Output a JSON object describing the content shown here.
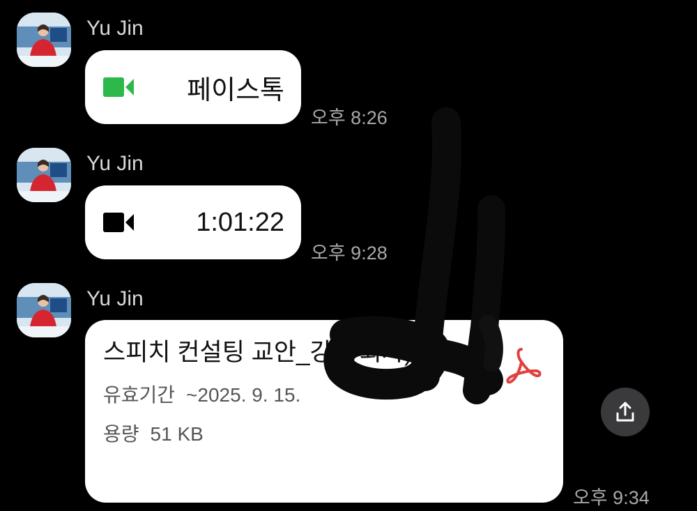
{
  "messages": [
    {
      "sender": "Yu Jin",
      "type": "call",
      "icon": "video-camera-icon",
      "icon_color": "#2db84c",
      "label": "페이스톡",
      "time": "오후 8:26"
    },
    {
      "sender": "Yu Jin",
      "type": "call",
      "icon": "video-camera-icon",
      "icon_color": "#000000",
      "label": "1:01:22",
      "time": "오후 9:28"
    },
    {
      "sender": "Yu Jin",
      "type": "file",
      "file_name": "스피치 컨설팅 교안_강            1 회차).pdf",
      "file_icon": "pdf-icon",
      "file_icon_color": "#e0403f",
      "validity_label": "유효기간",
      "validity_value": "~2025. 9. 15.",
      "size_label": "용량",
      "size_value": "51 KB",
      "share_icon": "share-icon",
      "time": "오후 9:34"
    }
  ],
  "colors": {
    "background": "#000000",
    "bubble": "#ffffff",
    "facetalk_green": "#2db84c",
    "pdf_red": "#e0403f"
  }
}
